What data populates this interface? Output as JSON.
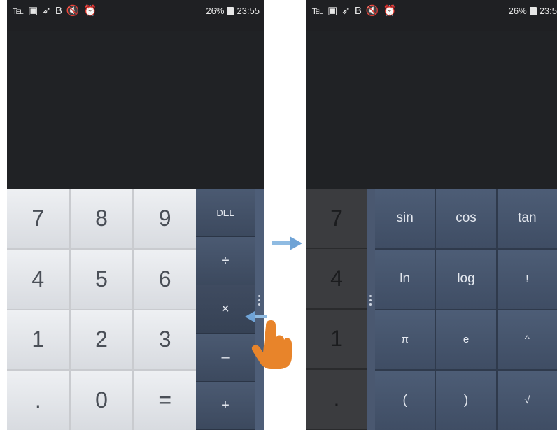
{
  "status_bar": {
    "icons": [
      "missed-call-icon",
      "notification-icon",
      "location-icon",
      "b-icon",
      "mute-icon",
      "alarm-icon"
    ],
    "icon_glyphs": [
      "℡",
      "▣",
      "➶",
      "B",
      "🔇",
      "⏰"
    ],
    "battery_percent": "26%",
    "time_left": "23:55",
    "time_right": "23:5"
  },
  "basic_keypad": {
    "keys": [
      "7",
      "8",
      "9",
      "4",
      "5",
      "6",
      "1",
      "2",
      "3",
      ".",
      "0",
      "="
    ]
  },
  "operators": {
    "keys": [
      "DEL",
      "÷",
      "×",
      "–",
      "+"
    ]
  },
  "dimmed_keys": [
    "7",
    "4",
    "1",
    "."
  ],
  "scientific_keypad": {
    "keys": [
      "sin",
      "cos",
      "tan",
      "ln",
      "log",
      "!",
      "π",
      "e",
      "^",
      "(",
      ")",
      "√"
    ]
  },
  "colors": {
    "display_bg": "#202225",
    "key_light": "#e6e8ec",
    "operator_bg": "#44526a",
    "accent_hand": "#e8842a",
    "arrow_blue": "#6fa3d6"
  }
}
